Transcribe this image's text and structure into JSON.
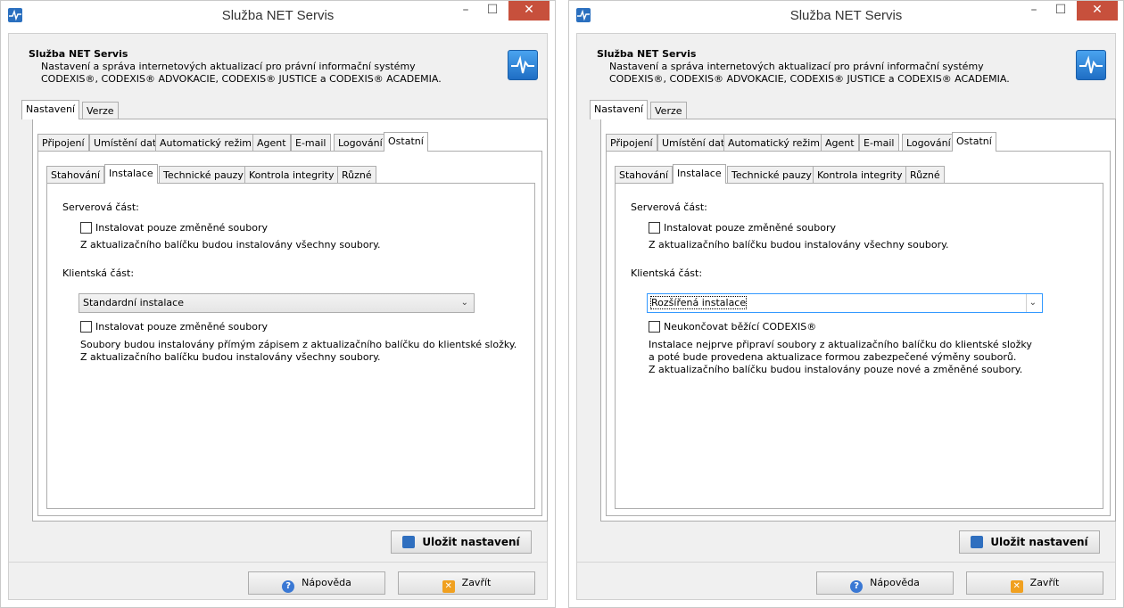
{
  "windows": [
    {
      "title": "Služba NET Servis",
      "header": {
        "title": "Služba NET Servis",
        "desc1": "Nastavení a správa internetových aktualizací pro právní informační systémy",
        "desc2": "CODEXIS®, CODEXIS® ADVOKACIE, CODEXIS® JUSTICE a CODEXIS® ACADEMIA."
      },
      "main_tabs": [
        "Nastavení",
        "Verze"
      ],
      "sub_tabs": [
        "Připojení",
        "Umístění dat",
        "Automatický režim",
        "Agent",
        "E-mail",
        "Logování",
        "Ostatní"
      ],
      "inner_tabs": [
        "Stahování",
        "Instalace",
        "Technické pauzy",
        "Kontrola integrity",
        "Různé"
      ],
      "server_label": "Serverová část:",
      "server_checkbox": "Instalovat pouze změněné soubory",
      "server_note": "Z aktualizačního balíčku budou instalovány všechny soubory.",
      "client_label": "Klientská část:",
      "client_select": "Standardní instalace",
      "client_checkbox": "Instalovat pouze změněné soubory",
      "client_note": [
        "Soubory budou instalovány přímým zápisem z aktualizačního balíčku do klientské složky.",
        "Z aktualizačního balíčku budou instalovány všechny soubory."
      ],
      "save_button": "Uložit nastavení",
      "help_button": "Nápověda",
      "close_button": "Zavřít"
    },
    {
      "title": "Služba NET Servis",
      "header": {
        "title": "Služba NET Servis",
        "desc1": "Nastavení a správa internetových aktualizací pro právní informační systémy",
        "desc2": "CODEXIS®, CODEXIS® ADVOKACIE, CODEXIS® JUSTICE a CODEXIS® ACADEMIA."
      },
      "main_tabs": [
        "Nastavení",
        "Verze"
      ],
      "sub_tabs": [
        "Připojení",
        "Umístění dat",
        "Automatický režim",
        "Agent",
        "E-mail",
        "Logování",
        "Ostatní"
      ],
      "inner_tabs": [
        "Stahování",
        "Instalace",
        "Technické pauzy",
        "Kontrola integrity",
        "Různé"
      ],
      "server_label": "Serverová část:",
      "server_checkbox": "Instalovat pouze změněné soubory",
      "server_note": "Z aktualizačního balíčku budou instalovány všechny soubory.",
      "client_label": "Klientská část:",
      "client_select": "Rozšířená instalace",
      "client_checkbox": "Neukončovat běžící CODEXIS®",
      "client_note": [
        "Instalace nejprve připraví soubory z aktualizačního balíčku do klientské složky",
        "a poté bude provedena aktualizace formou zabezpečené výměny souborů.",
        "Z aktualizačního balíčku budou instalovány pouze nové a změněné soubory."
      ],
      "save_button": "Uložit nastavení",
      "help_button": "Nápověda",
      "close_button": "Zavřít"
    }
  ]
}
